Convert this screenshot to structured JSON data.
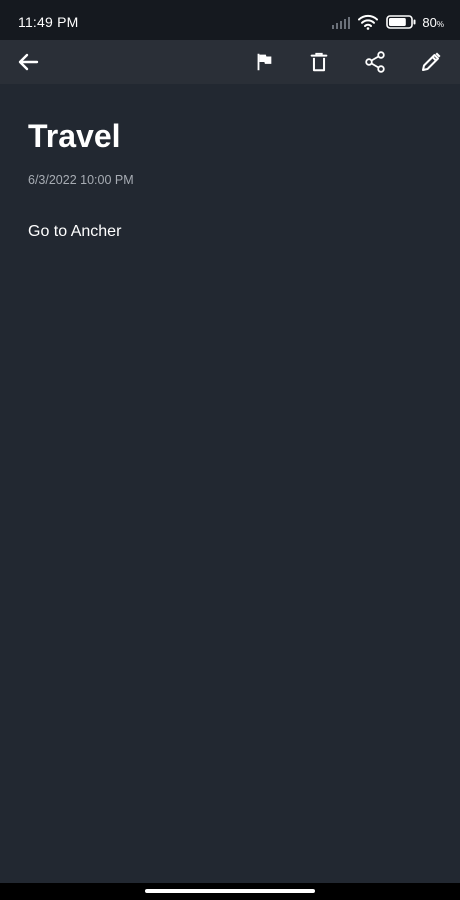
{
  "status_bar": {
    "time": "11:49 PM",
    "battery_percent": "80",
    "battery_unit": "%",
    "battery_level": 0.8,
    "icons": [
      "signal-icon",
      "wifi-icon",
      "battery-icon"
    ]
  },
  "toolbar": {
    "icons": [
      "back-arrow-icon",
      "flag-icon",
      "delete-icon",
      "share-icon",
      "edit-pencil-icon"
    ]
  },
  "note": {
    "title": "Travel",
    "date": "6/3/2022 10:00 PM",
    "body": "Go to Ancher"
  },
  "colors": {
    "background": "#222831",
    "status_bar": "#15191f",
    "toolbar": "#2a2f37",
    "text_primary": "#ffffff",
    "text_secondary": "#a7acb3"
  }
}
